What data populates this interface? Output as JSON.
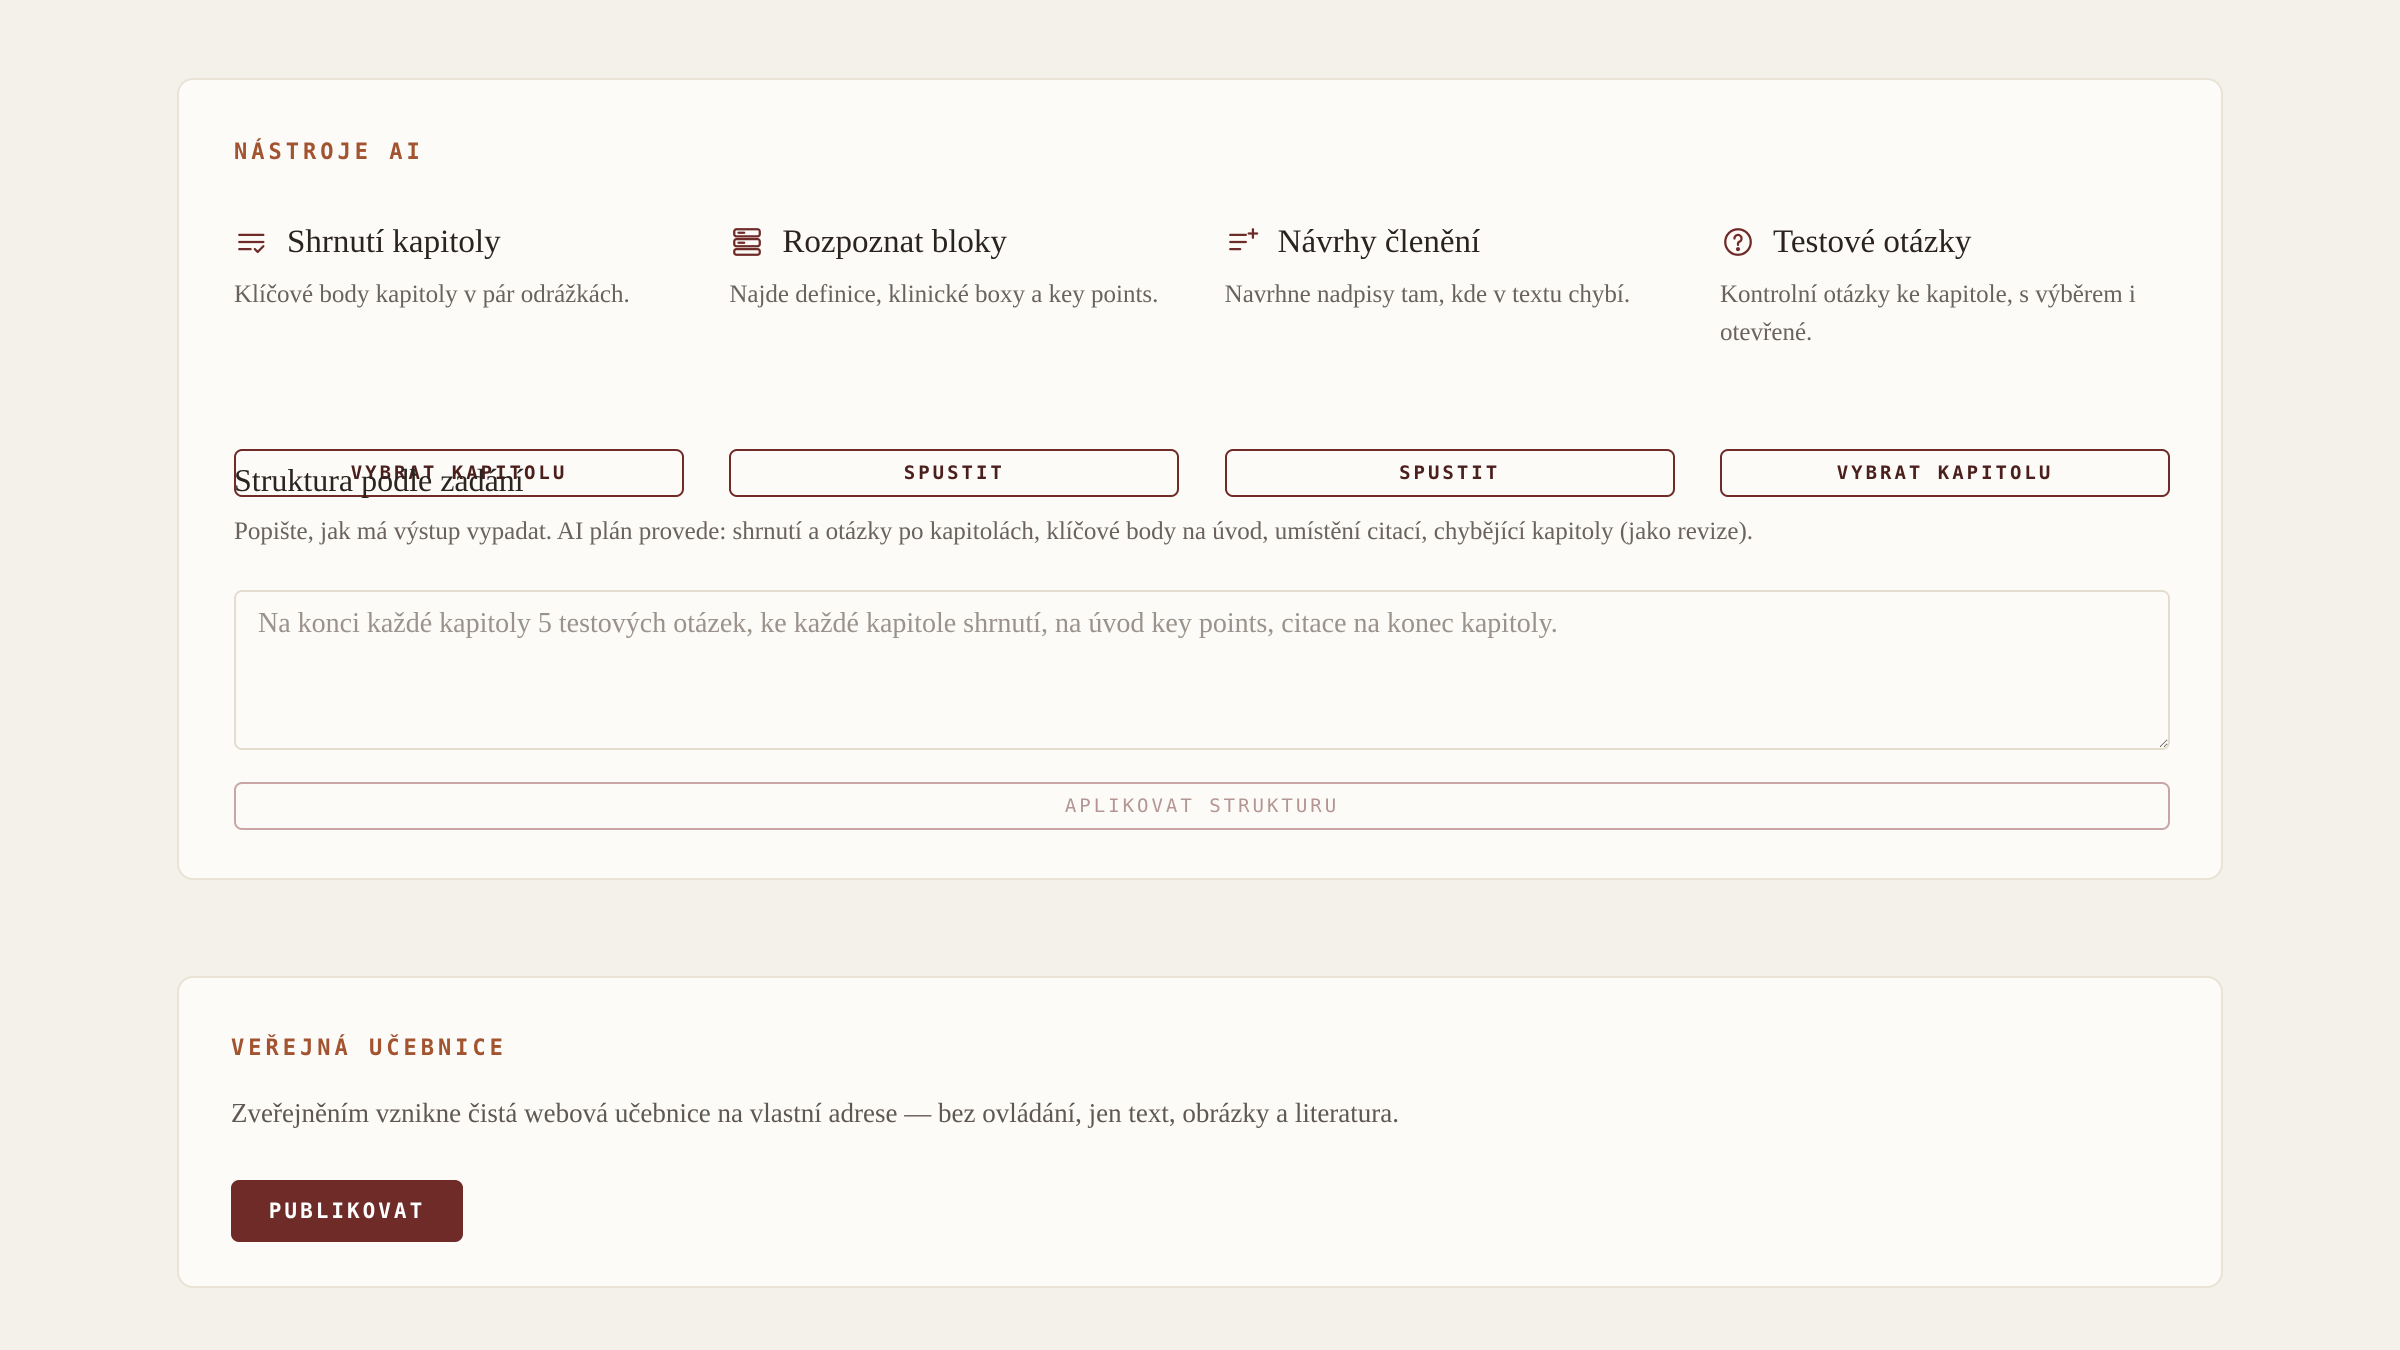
{
  "ai_tools": {
    "eyebrow": "NÁSTROJE AI",
    "tools": [
      {
        "icon": "summary-list-icon",
        "title": "Shrnutí kapitoly",
        "description": "Klíčové body kapitoly v pár odrážkách.",
        "button": "VYBRAT KAPITOLU"
      },
      {
        "icon": "blocks-icon",
        "title": "Rozpoznat bloky",
        "description": "Najde definice, klinické boxy a key points.",
        "button": "SPUSTIT"
      },
      {
        "icon": "outline-add-icon",
        "title": "Návrhy členění",
        "description": "Navrhne nadpisy tam, kde v textu chybí.",
        "button": "SPUSTIT"
      },
      {
        "icon": "question-circle-icon",
        "title": "Testové otázky",
        "description": "Kontrolní otázky ke kapitole, s výběrem i otevřené.",
        "button": "VYBRAT KAPITOLU"
      }
    ],
    "structure": {
      "title": "Struktura podle zadání",
      "description": "Popište, jak má výstup vypadat. AI plán provede: shrnutí a otázky po kapitolách, klíčové body na úvod, umístění citací, chybějící kapitoly (jako revize).",
      "placeholder": "Na konci každé kapitoly 5 testových otázek, ke každé kapitole shrnutí, na úvod key points, citace na konec kapitoly.",
      "value": "",
      "apply_label": "APLIKOVAT STRUKTURU"
    }
  },
  "publish": {
    "eyebrow": "VEŘEJNÁ UČEBNICE",
    "description": "Zveřejněním vznikne čistá webová učebnice na vlastní adrese — bez ovládání, jen text, obrázky a literatura.",
    "button": "PUBLIKOVAT"
  },
  "colors": {
    "accent": "#6e2b28",
    "eyebrow": "#a2532f",
    "background": "#f4f1ea",
    "card": "#fcfbf8"
  }
}
